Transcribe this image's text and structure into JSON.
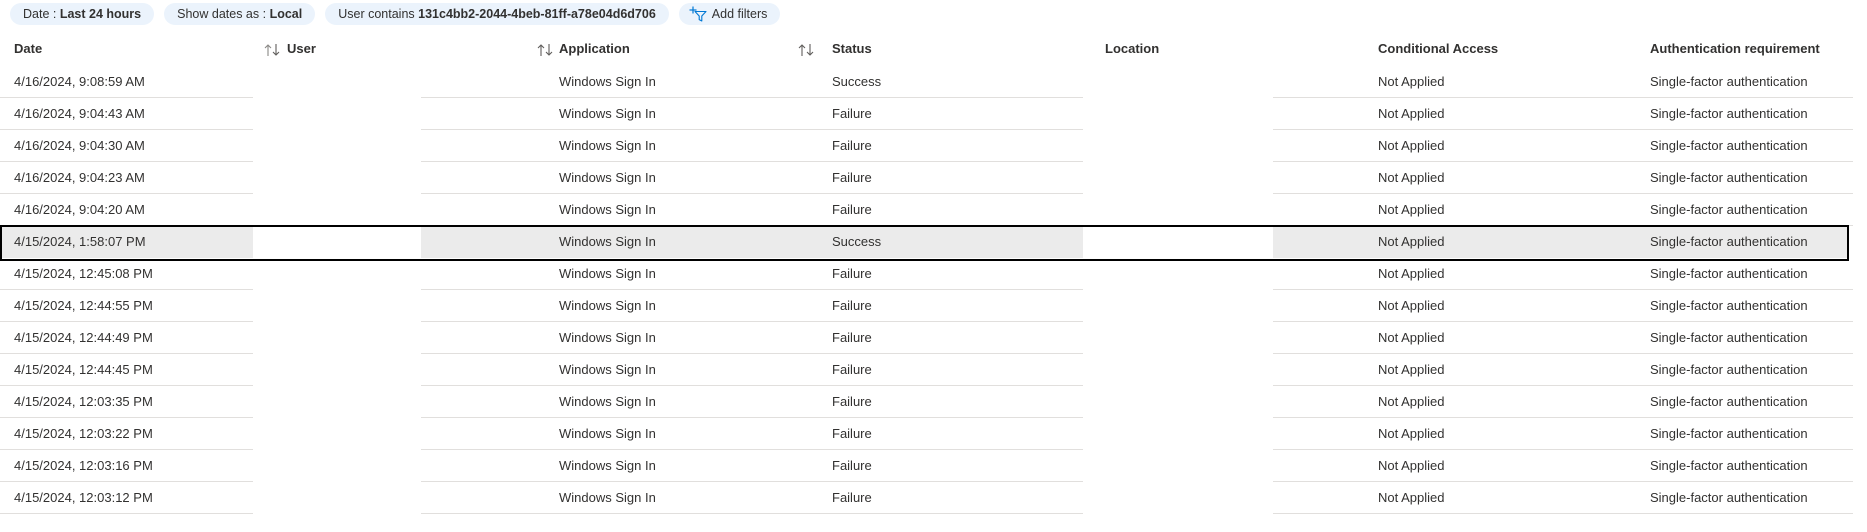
{
  "filters": {
    "date": {
      "prefix": "Date :",
      "value": "Last 24 hours"
    },
    "show_dates": {
      "prefix": "Show dates as :",
      "value": "Local"
    },
    "user": {
      "prefix": "User contains",
      "value": "131c4bb2-2044-4beb-81ff-a78e04d6d706"
    },
    "add_label": "Add filters"
  },
  "columns": {
    "date": "Date",
    "user": "User",
    "application": "Application",
    "status": "Status",
    "location": "Location",
    "conditional_access": "Conditional Access",
    "auth_requirement": "Authentication requirement"
  },
  "rows": [
    {
      "date": "4/16/2024, 9:08:59 AM",
      "user": "",
      "application": "Windows Sign In",
      "status": "Success",
      "location": "",
      "conditional_access": "Not Applied",
      "auth_requirement": "Single-factor authentication"
    },
    {
      "date": "4/16/2024, 9:04:43 AM",
      "user": "",
      "application": "Windows Sign In",
      "status": "Failure",
      "location": "",
      "conditional_access": "Not Applied",
      "auth_requirement": "Single-factor authentication"
    },
    {
      "date": "4/16/2024, 9:04:30 AM",
      "user": "",
      "application": "Windows Sign In",
      "status": "Failure",
      "location": "",
      "conditional_access": "Not Applied",
      "auth_requirement": "Single-factor authentication"
    },
    {
      "date": "4/16/2024, 9:04:23 AM",
      "user": "",
      "application": "Windows Sign In",
      "status": "Failure",
      "location": "",
      "conditional_access": "Not Applied",
      "auth_requirement": "Single-factor authentication"
    },
    {
      "date": "4/16/2024, 9:04:20 AM",
      "user": "",
      "application": "Windows Sign In",
      "status": "Failure",
      "location": "",
      "conditional_access": "Not Applied",
      "auth_requirement": "Single-factor authentication"
    },
    {
      "date": "4/15/2024, 1:58:07 PM",
      "user": "",
      "application": "Windows Sign In",
      "status": "Success",
      "location": "",
      "conditional_access": "Not Applied",
      "auth_requirement": "Single-factor authentication"
    },
    {
      "date": "4/15/2024, 12:45:08 PM",
      "user": "",
      "application": "Windows Sign In",
      "status": "Failure",
      "location": "",
      "conditional_access": "Not Applied",
      "auth_requirement": "Single-factor authentication"
    },
    {
      "date": "4/15/2024, 12:44:55 PM",
      "user": "",
      "application": "Windows Sign In",
      "status": "Failure",
      "location": "",
      "conditional_access": "Not Applied",
      "auth_requirement": "Single-factor authentication"
    },
    {
      "date": "4/15/2024, 12:44:49 PM",
      "user": "",
      "application": "Windows Sign In",
      "status": "Failure",
      "location": "",
      "conditional_access": "Not Applied",
      "auth_requirement": "Single-factor authentication"
    },
    {
      "date": "4/15/2024, 12:44:45 PM",
      "user": "",
      "application": "Windows Sign In",
      "status": "Failure",
      "location": "",
      "conditional_access": "Not Applied",
      "auth_requirement": "Single-factor authentication"
    },
    {
      "date": "4/15/2024, 12:03:35 PM",
      "user": "",
      "application": "Windows Sign In",
      "status": "Failure",
      "location": "",
      "conditional_access": "Not Applied",
      "auth_requirement": "Single-factor authentication"
    },
    {
      "date": "4/15/2024, 12:03:22 PM",
      "user": "",
      "application": "Windows Sign In",
      "status": "Failure",
      "location": "",
      "conditional_access": "Not Applied",
      "auth_requirement": "Single-factor authentication"
    },
    {
      "date": "4/15/2024, 12:03:16 PM",
      "user": "",
      "application": "Windows Sign In",
      "status": "Failure",
      "location": "",
      "conditional_access": "Not Applied",
      "auth_requirement": "Single-factor authentication"
    },
    {
      "date": "4/15/2024, 12:03:12 PM",
      "user": "",
      "application": "Windows Sign In",
      "status": "Failure",
      "location": "",
      "conditional_access": "Not Applied",
      "auth_requirement": "Single-factor authentication"
    }
  ],
  "selected_row": 5,
  "icons": {
    "add_filter": "filter-plus-icon",
    "sort": "sort-arrows-icon"
  },
  "colors": {
    "pill_background": "#ebf3fc",
    "accent": "#0078d4",
    "row_highlight": "#ebebeb",
    "divider": "#e1dfdd"
  }
}
